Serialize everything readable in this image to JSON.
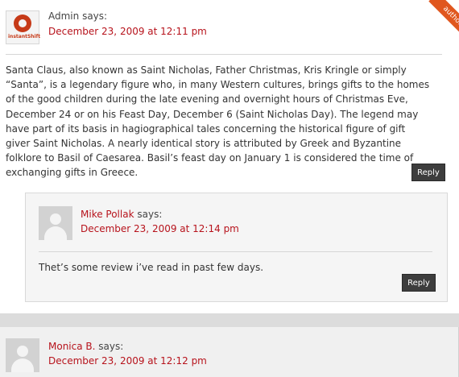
{
  "comments": [
    {
      "author": "Admin",
      "says": "says:",
      "date": "December 23, 2009 at 12:11 pm",
      "avatar_logo_text": "instantShift",
      "badge": "author",
      "body": "Santa Claus, also known as Saint Nicholas, Father Christmas, Kris Kringle or simply “Santa”, is a legendary figure who, in many Western cultures, brings gifts to the homes of the good children during the late evening and overnight hours of Christmas Eve, December 24 or on his Feast Day, December 6 (Saint Nicholas Day). The legend may have part of its basis in hagiographical tales concerning the historical figure of gift giver Saint Nicholas. A nearly identical story is attributed by Greek and Byzantine folklore to Basil of Caesarea. Basil’s feast day on January 1 is considered the time of exchanging gifts in Greece.",
      "reply_label": "Reply"
    },
    {
      "author": "Mike Pollak",
      "says": "says:",
      "date": "December 23, 2009 at 12:14 pm",
      "body": "Thet’s some review i’ve read in past few days.",
      "reply_label": "Reply"
    },
    {
      "author": "Monica B.",
      "says": "says:",
      "date": "December 23, 2009 at 12:12 pm"
    }
  ],
  "colors": {
    "link": "#b7131c",
    "ribbon": "#e0571e",
    "reply_button": "#3d3d3d"
  },
  "icons": {
    "admin_avatar": "instantshift-logo",
    "user_avatar": "default-user-silhouette-icon"
  }
}
